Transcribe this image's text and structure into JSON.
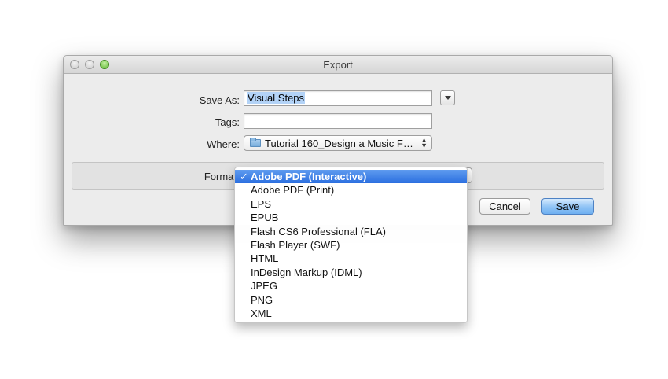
{
  "window": {
    "title": "Export"
  },
  "form": {
    "save_as_label": "Save As:",
    "save_as_value": "Visual Steps",
    "tags_label": "Tags:",
    "tags_value": "",
    "where_label": "Where:",
    "where_value": "Tutorial 160_Design a Music F…",
    "format_label": "Format"
  },
  "format_menu": {
    "checkmark": "✓",
    "items": [
      "Adobe PDF (Interactive)",
      "Adobe PDF (Print)",
      "EPS",
      "EPUB",
      "Flash CS6 Professional (FLA)",
      "Flash Player (SWF)",
      "HTML",
      "InDesign Markup (IDML)",
      "JPEG",
      "PNG",
      "XML"
    ],
    "selected_index": 0
  },
  "buttons": {
    "cancel": "Cancel",
    "save": "Save"
  },
  "icons": {
    "close": "close-icon",
    "minimize": "minimize-icon",
    "zoom": "zoom-icon",
    "folder": "folder-icon",
    "expand": "disclosure-triangle-icon",
    "updown": "up-down-arrows-icon"
  },
  "colors": {
    "accent": "#2b6fe0",
    "selection": "#b3d3f7",
    "zoom_green": "#58b22c"
  }
}
